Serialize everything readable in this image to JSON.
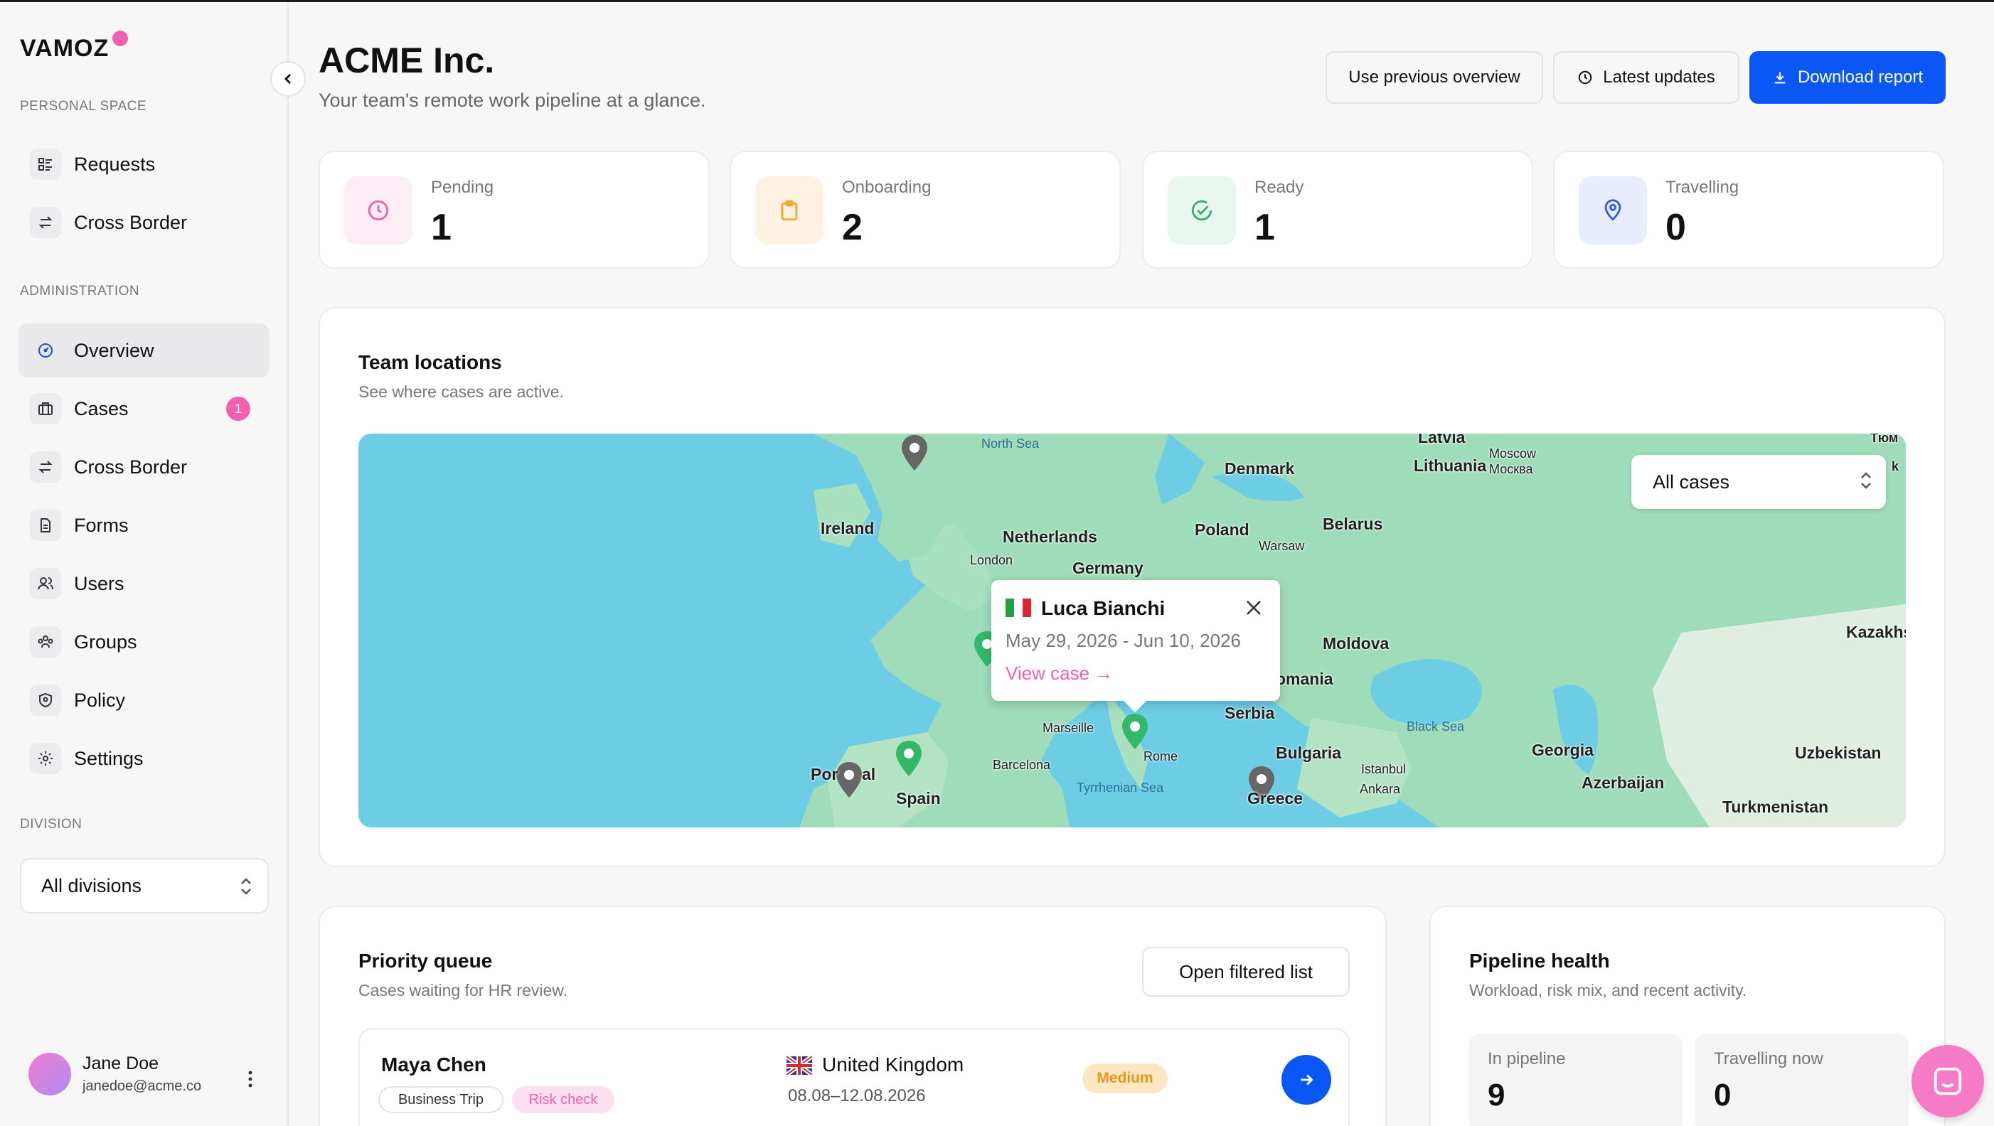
{
  "app": {
    "logo": "VAMOZ"
  },
  "sidebar": {
    "personal_label": "PERSONAL SPACE",
    "personal_items": [
      {
        "label": "Requests",
        "icon": "list-icon"
      },
      {
        "label": "Cross Border",
        "icon": "swap-icon"
      }
    ],
    "admin_label": "ADMINISTRATION",
    "admin_items": [
      {
        "label": "Overview",
        "icon": "gauge-icon",
        "active": true
      },
      {
        "label": "Cases",
        "icon": "briefcase-icon",
        "badge": "1"
      },
      {
        "label": "Cross Border",
        "icon": "swap-icon"
      },
      {
        "label": "Forms",
        "icon": "document-icon"
      },
      {
        "label": "Users",
        "icon": "users-icon"
      },
      {
        "label": "Groups",
        "icon": "groups-icon"
      },
      {
        "label": "Policy",
        "icon": "shield-icon"
      },
      {
        "label": "Settings",
        "icon": "gear-icon"
      }
    ],
    "division_label": "DIVISION",
    "division_value": "All divisions",
    "user": {
      "name": "Jane Doe",
      "email": "janedoe@acme.co"
    }
  },
  "header": {
    "title": "ACME Inc.",
    "subtitle": "Your team's remote work pipeline at a glance.",
    "btn_previous": "Use previous overview",
    "btn_updates": "Latest updates",
    "btn_download": "Download report"
  },
  "stats": [
    {
      "label": "Pending",
      "value": "1",
      "icon": "clock-icon",
      "color": "#f35fb0"
    },
    {
      "label": "Onboarding",
      "value": "2",
      "icon": "clipboard-icon",
      "color": "#f0a531"
    },
    {
      "label": "Ready",
      "value": "1",
      "icon": "check-circle-icon",
      "color": "#2fb36b"
    },
    {
      "label": "Travelling",
      "value": "0",
      "icon": "location-pin-icon",
      "color": "#2e5be0"
    }
  ],
  "map_card": {
    "title": "Team locations",
    "subtitle": "See where cases are active.",
    "filter_value": "All cases",
    "popup": {
      "name": "Luca Bianchi",
      "dates": "May 29, 2026 - Jun 10, 2026",
      "link": "View case →"
    },
    "labels": {
      "north_sea": "North Sea",
      "denmark": "Denmark",
      "latvia": "Latvia",
      "lithuania": "Lithuania",
      "moscow": "Moscow",
      "moscow_ru": "Москва",
      "ireland": "Ireland",
      "netherlands": "Netherlands",
      "poland": "Poland",
      "belarus": "Belarus",
      "london": "London",
      "warsaw": "Warsaw",
      "germany": "Germany",
      "kazakh": "Kazakhs",
      "moldova": "Moldova",
      "romania": "omania",
      "black_sea": "Black Sea",
      "serbia": "Serbia",
      "marseille": "Marseille",
      "bulgaria": "Bulgaria",
      "georgia": "Georgia",
      "uzbekistan": "Uzbekistan",
      "portugal": "Por",
      "portugal2": "al",
      "barcelona": "Barcelona",
      "rome": "Rome",
      "istanbul": "Istanbul",
      "ankara": "Ankara",
      "azerbaijan": "Azerbaijan",
      "spain": "Spain",
      "tyrrhenian": "Tyrrhenian Sea",
      "greece": "Greece",
      "turkmenistan": "Turkmenistan",
      "tyum": "Тюм",
      "k_edge": "k"
    }
  },
  "priority": {
    "title": "Priority queue",
    "subtitle": "Cases waiting for HR review.",
    "open_btn": "Open filtered list",
    "rows": [
      {
        "name": "Maya Chen",
        "tags": [
          "Business Trip",
          "Risk check"
        ],
        "country": "United Kingdom",
        "dates": "08.08–12.08.2026",
        "priority": "Medium"
      }
    ]
  },
  "pipeline": {
    "title": "Pipeline health",
    "subtitle": "Workload, risk mix, and recent activity.",
    "boxes": [
      {
        "label": "In pipeline",
        "value": "9"
      },
      {
        "label": "Travelling now",
        "value": "0"
      }
    ]
  }
}
